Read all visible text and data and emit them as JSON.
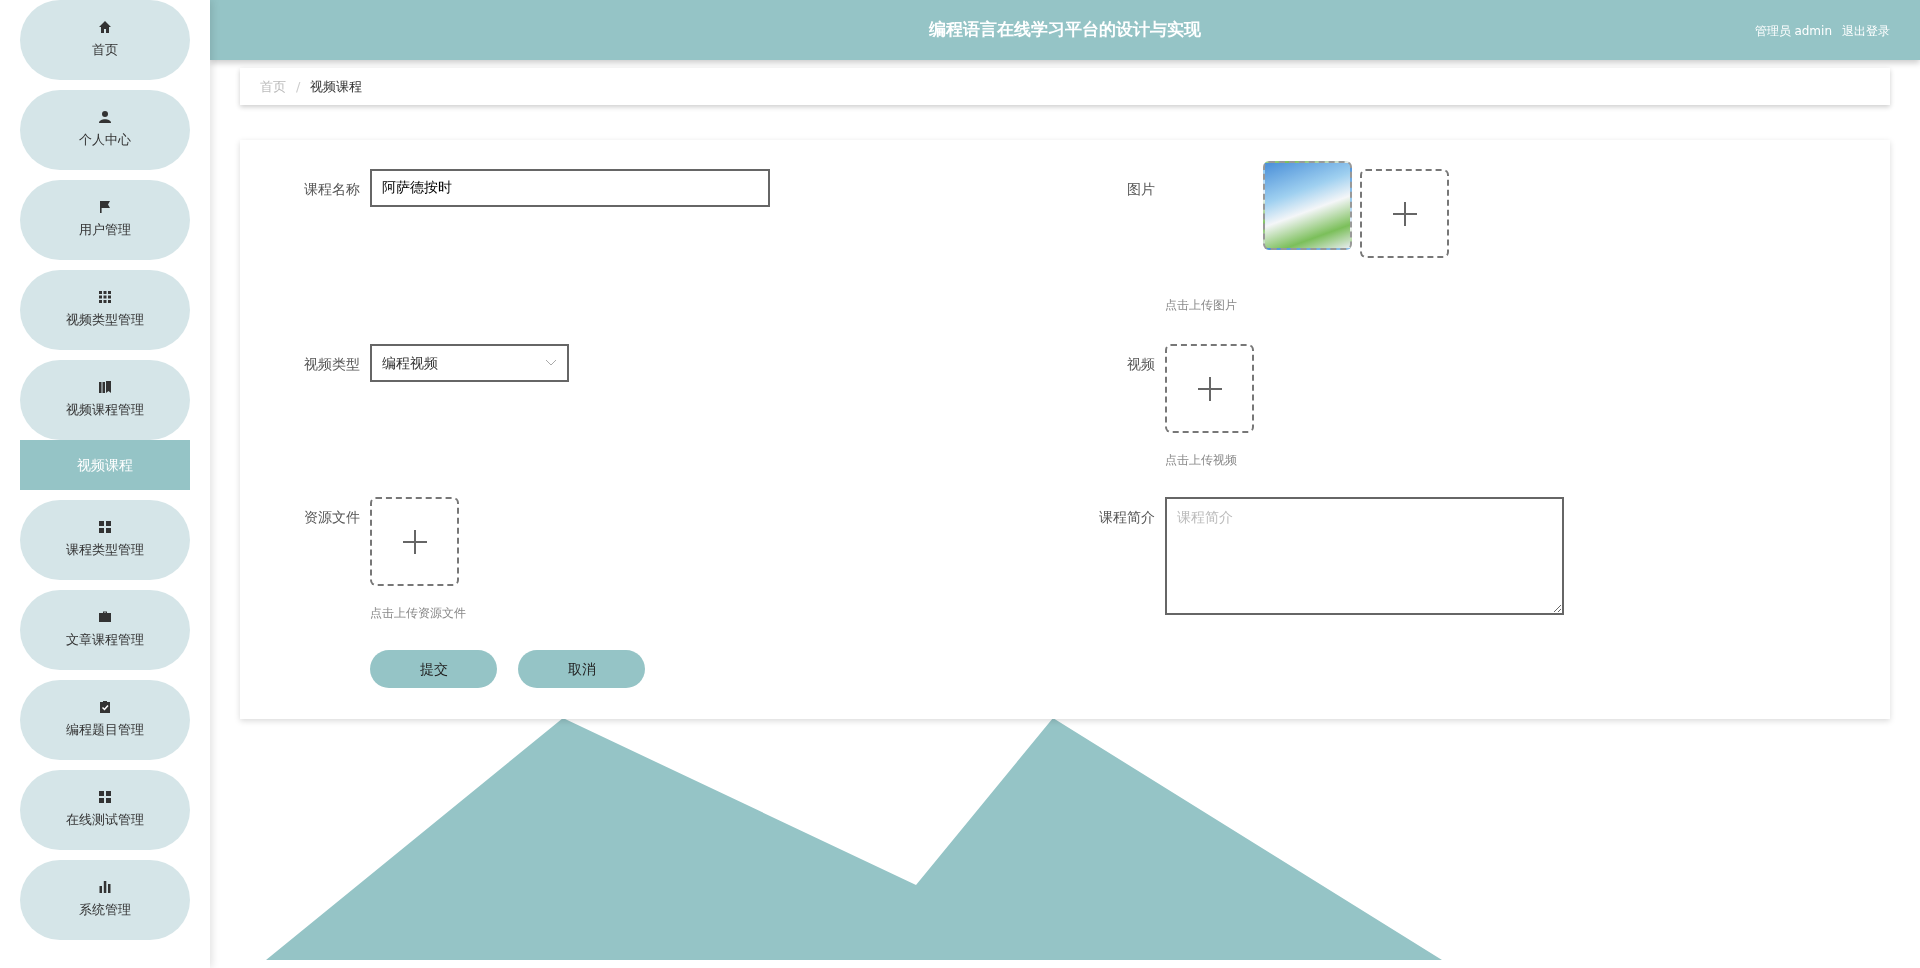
{
  "header": {
    "title": "编程语言在线学习平台的设计与实现",
    "user": "管理员 admin",
    "logout": "退出登录"
  },
  "sidebar": {
    "items": [
      {
        "kind": "menu",
        "label": "首页",
        "selected": false
      },
      {
        "kind": "menu",
        "label": "个人中心",
        "selected": false
      },
      {
        "kind": "menu",
        "label": "用户管理",
        "selected": false
      },
      {
        "kind": "menu",
        "label": "视频类型管理",
        "selected": false
      },
      {
        "kind": "menu",
        "label": "视频课程管理",
        "selected": false
      },
      {
        "kind": "submenu",
        "label": "视频课程",
        "selected": true
      },
      {
        "kind": "menu",
        "label": "课程类型管理",
        "selected": false
      },
      {
        "kind": "menu",
        "label": "文章课程管理",
        "selected": false
      },
      {
        "kind": "menu",
        "label": "编程题目管理",
        "selected": false
      },
      {
        "kind": "menu",
        "label": "在线测试管理",
        "selected": false
      },
      {
        "kind": "menu",
        "label": "系统管理",
        "selected": false
      }
    ]
  },
  "breadcrumb": {
    "separator": "/",
    "items": [
      {
        "label": "首页",
        "selected": false
      },
      {
        "label": "视频课程",
        "selected": true
      }
    ]
  },
  "form": {
    "left": [
      {
        "kind": "text",
        "label": "课程名称",
        "value": "阿萨德按时"
      },
      {
        "kind": "select",
        "label": "视频类型",
        "value": "编程视频"
      },
      {
        "kind": "upload",
        "label": "资源文件",
        "caption": "点击上传资源文件",
        "has_image": false
      }
    ],
    "right": [
      {
        "kind": "upload",
        "label": "图片",
        "caption": "点击上传图片",
        "has_image": true
      },
      {
        "kind": "upload",
        "label": "视频",
        "caption": "点击上传视频",
        "has_image": false
      },
      {
        "kind": "textarea",
        "label": "课程简介",
        "placeholder": "课程简介"
      }
    ],
    "buttons": [
      {
        "label": "提交"
      },
      {
        "label": "取消"
      }
    ]
  }
}
